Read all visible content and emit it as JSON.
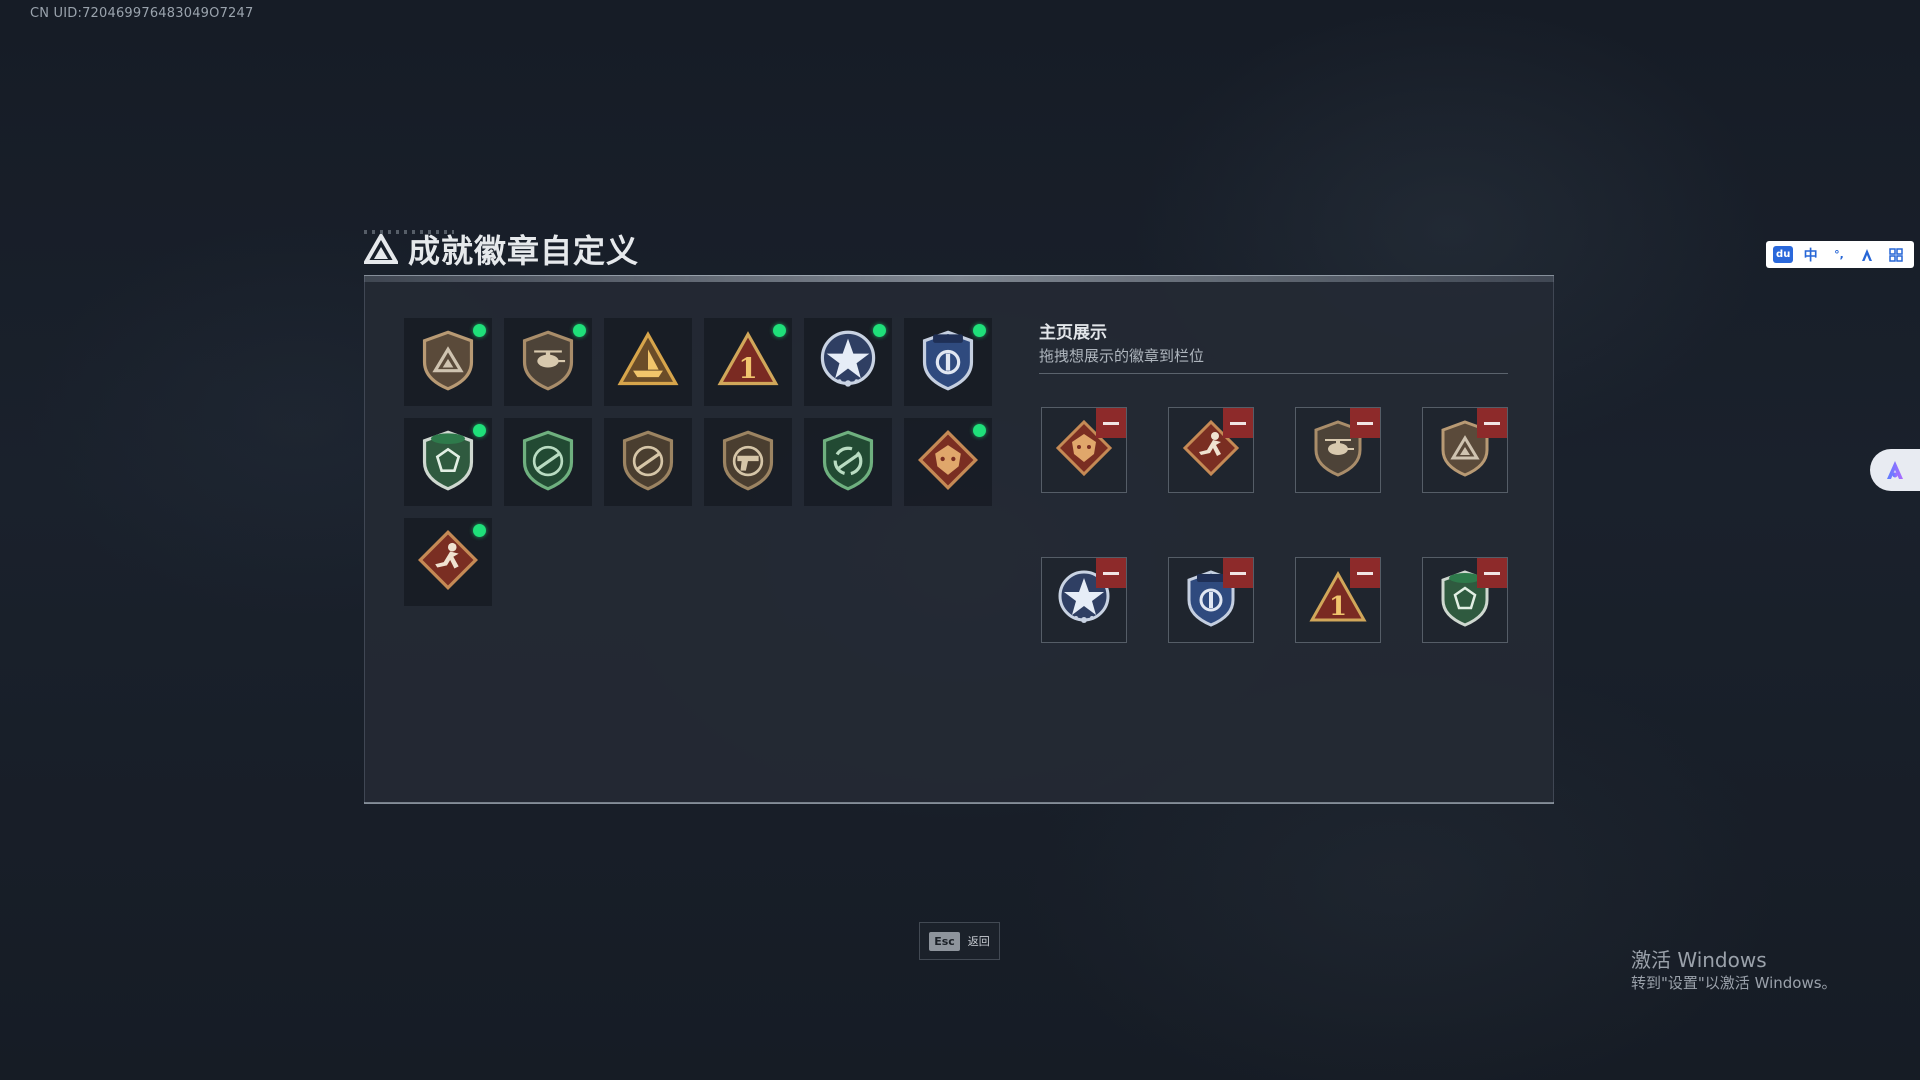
{
  "uid_text": "CN UID:720469976483049O7247",
  "title": "成就徽章自定义",
  "badges": [
    {
      "icon": "bronze-triangle-shield-icon",
      "unlocked": true
    },
    {
      "icon": "helicopter-shield-icon",
      "unlocked": true
    },
    {
      "icon": "gold-ship-triangle-icon",
      "unlocked": false
    },
    {
      "icon": "red-number-one-triangle-icon",
      "unlocked": true
    },
    {
      "icon": "silver-star-medal-icon",
      "unlocked": true
    },
    {
      "icon": "blue-police-shield-icon",
      "unlocked": true
    },
    {
      "icon": "green-beret-shield-icon",
      "unlocked": true
    },
    {
      "icon": "green-rifle-shield-icon",
      "unlocked": false
    },
    {
      "icon": "bronze-rifle-shield-icon",
      "unlocked": false
    },
    {
      "icon": "bronze-pistol-shield-icon",
      "unlocked": false
    },
    {
      "icon": "green-cycle-shield-icon",
      "unlocked": false
    },
    {
      "icon": "red-dragon-diamond-icon",
      "unlocked": true
    },
    {
      "icon": "red-runner-diamond-icon",
      "unlocked": true
    }
  ],
  "showcase": {
    "title": "主页展示",
    "subtitle": "拖拽想展示的徽章到栏位",
    "slots": [
      {
        "icon": "red-dragon-diamond-icon"
      },
      {
        "icon": "red-runner-diamond-icon"
      },
      {
        "icon": "helicopter-shield-icon"
      },
      {
        "icon": "bronze-triangle-shield-icon"
      },
      {
        "icon": "silver-star-medal-icon"
      },
      {
        "icon": "blue-police-shield-icon"
      },
      {
        "icon": "red-number-one-triangle-icon"
      },
      {
        "icon": "green-beret-shield-icon"
      }
    ]
  },
  "esc": {
    "key": "Esc",
    "label": "返回"
  },
  "ime": {
    "logo": "du",
    "lang": "中",
    "punct": "°,"
  },
  "activation": {
    "title": "激活 Windows",
    "subtitle": "转到\"设置\"以激活 Windows。"
  },
  "colors": {
    "unlocked_dot": "#1fe07a",
    "remove_button": "#8d2a2a",
    "panel_bg": "#242a34"
  }
}
